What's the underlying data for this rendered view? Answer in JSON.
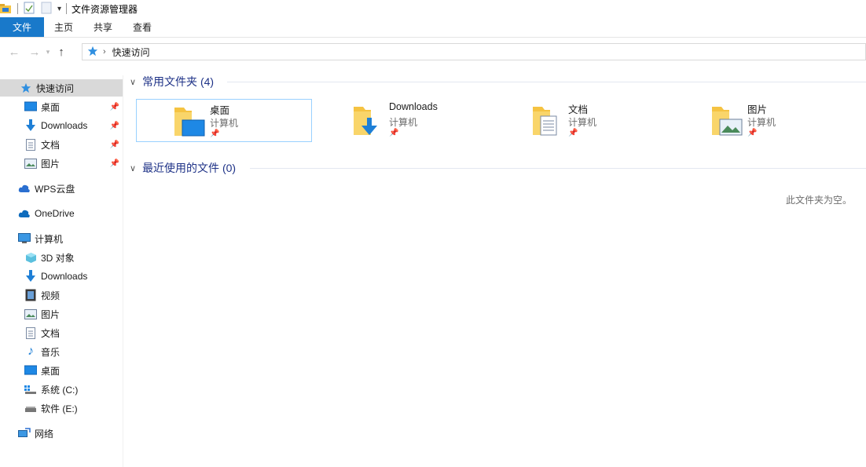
{
  "window": {
    "title": "文件资源管理器"
  },
  "ribbon": {
    "tabs": [
      "文件",
      "主页",
      "共享",
      "查看"
    ]
  },
  "address": {
    "path": "快速访问"
  },
  "sidebar": {
    "quick_access": "快速访问",
    "pinned": [
      {
        "label": "桌面",
        "icon": "desktop-icon"
      },
      {
        "label": "Downloads",
        "icon": "download-icon"
      },
      {
        "label": "文档",
        "icon": "document-icon"
      },
      {
        "label": "图片",
        "icon": "picture-icon"
      }
    ],
    "wps": "WPS云盘",
    "onedrive": "OneDrive",
    "computer": "计算机",
    "computer_items": [
      {
        "label": "3D 对象",
        "icon": "3d-objects-icon"
      },
      {
        "label": "Downloads",
        "icon": "download-icon"
      },
      {
        "label": "视频",
        "icon": "video-icon"
      },
      {
        "label": "图片",
        "icon": "picture-icon"
      },
      {
        "label": "文档",
        "icon": "document-icon"
      },
      {
        "label": "音乐",
        "icon": "music-icon"
      },
      {
        "label": "桌面",
        "icon": "desktop-icon"
      },
      {
        "label": "系统 (C:)",
        "icon": "system-drive-icon"
      },
      {
        "label": "软件 (E:)",
        "icon": "drive-icon"
      }
    ],
    "network": "网络"
  },
  "main": {
    "frequent_header": "常用文件夹 (4)",
    "folders": [
      {
        "name": "桌面",
        "location": "计算机"
      },
      {
        "name": "Downloads",
        "location": "计算机"
      },
      {
        "name": "文档",
        "location": "计算机"
      },
      {
        "name": "图片",
        "location": "计算机"
      }
    ],
    "recent_header": "最近使用的文件 (0)",
    "empty_text": "此文件夹为空。"
  },
  "colors": {
    "accent": "#1979ca",
    "group_header": "#1e3287",
    "selection": "#d9d9d9",
    "tile_border": "#99d1ff"
  }
}
